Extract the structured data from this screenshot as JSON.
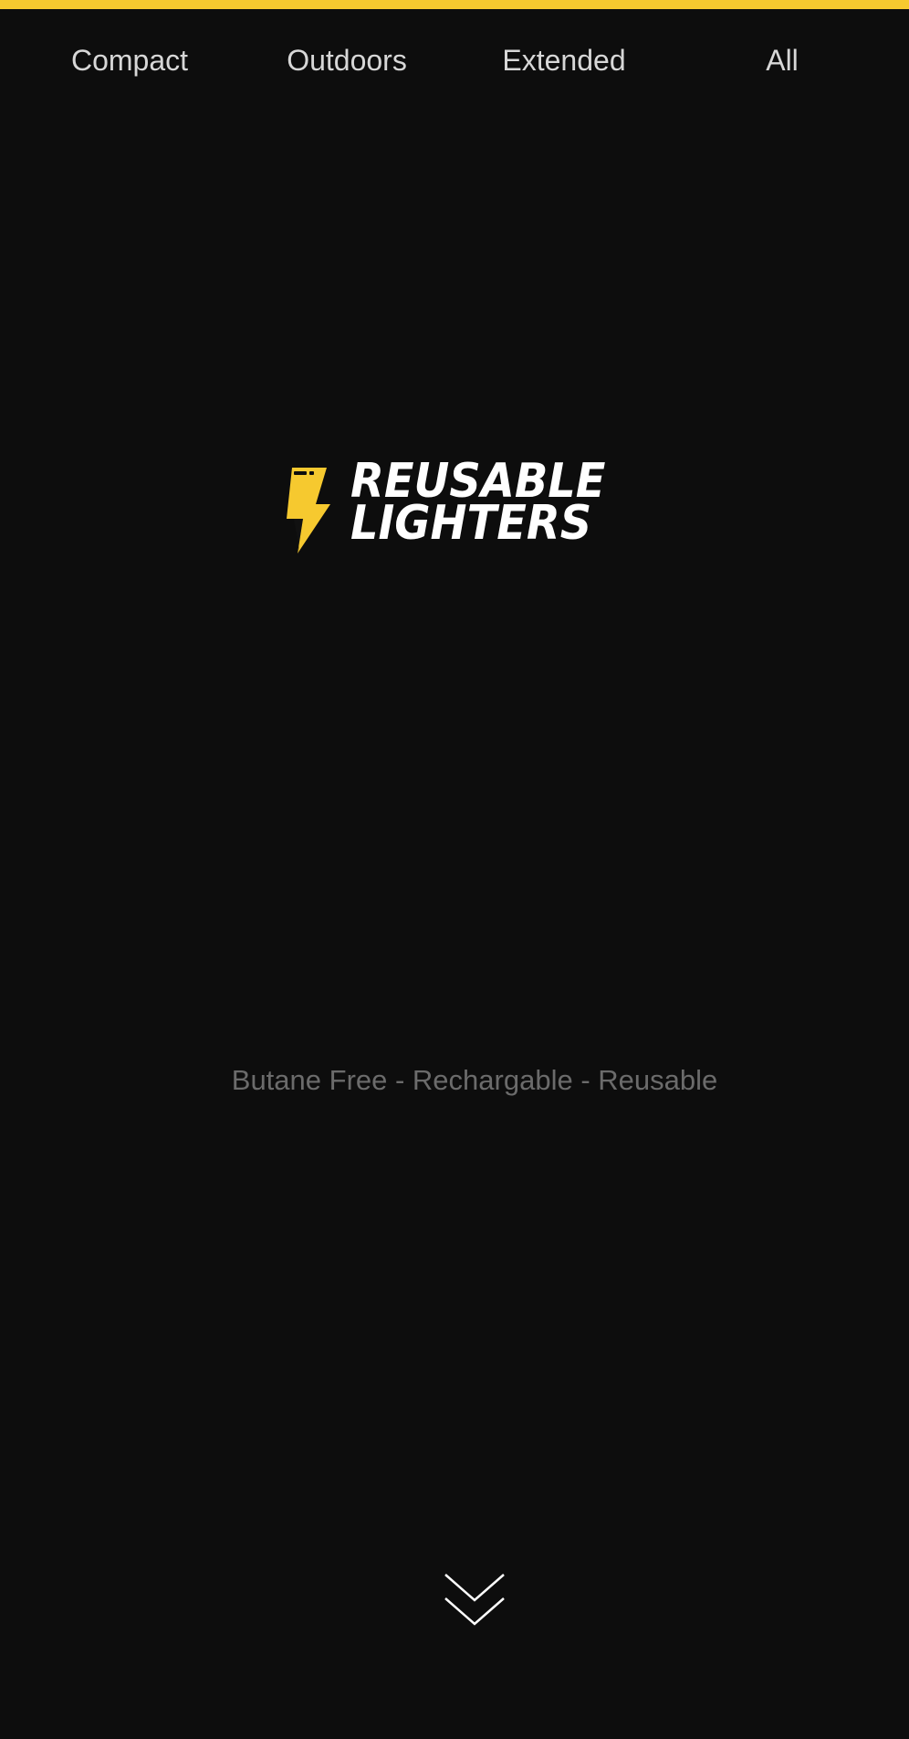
{
  "nav": {
    "items": [
      {
        "label": "Compact"
      },
      {
        "label": "Outdoors"
      },
      {
        "label": "Extended"
      },
      {
        "label": "All"
      }
    ]
  },
  "hero": {
    "logo": {
      "line1": "REUSABLE",
      "line2": "LIGHTERS",
      "icon": "lightning-bolt-icon"
    },
    "tagline": "Butane Free - Rechargable - Reusable",
    "scroll_icon": "double-chevron-down-icon"
  },
  "colors": {
    "accent": "#f6c92f",
    "background": "#0d0d0d",
    "nav_text": "#d7d7d7",
    "tagline_text": "#6b6b6b",
    "logo_text": "#ffffff"
  }
}
